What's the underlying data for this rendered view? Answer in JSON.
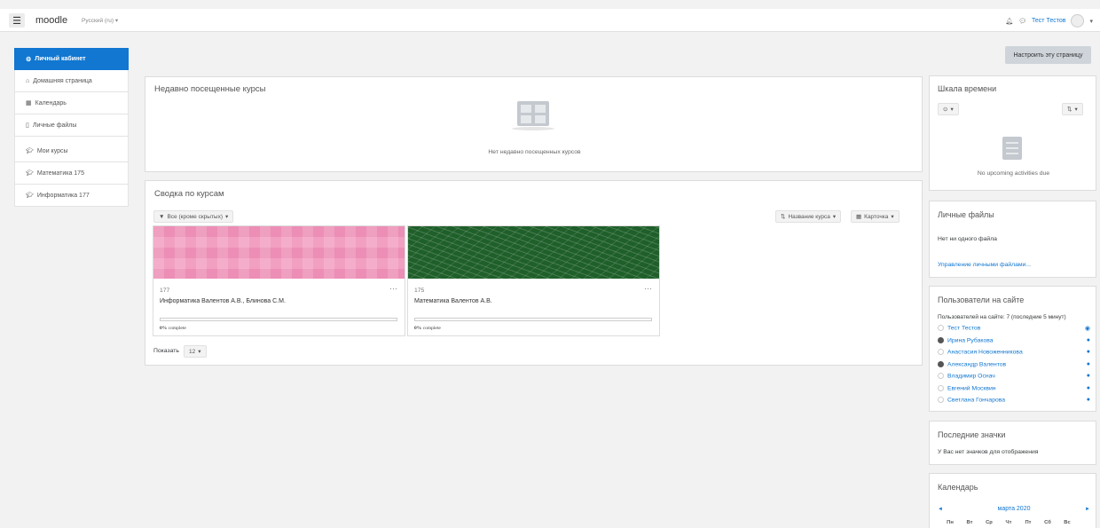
{
  "navbar": {
    "brand": "moodle",
    "language": "Русский (ru)",
    "user_name": "Тест Тестов"
  },
  "sidebar": {
    "items": [
      {
        "label": "Личный кабинет",
        "active": true
      },
      {
        "label": "Домашняя страница"
      },
      {
        "label": "Календарь"
      },
      {
        "label": "Личные файлы"
      },
      {
        "label": "Мои курсы"
      },
      {
        "label": "Математика 175"
      },
      {
        "label": "Информатика 177"
      }
    ]
  },
  "customize_button": "Настроить эту страницу",
  "recent": {
    "title": "Недавно посещенные курсы",
    "empty": "Нет недавно посещенных курсов"
  },
  "overview": {
    "title": "Сводка по курсам",
    "filter": "Все (кроме скрытых)",
    "sort": "Название курса",
    "view": "Карточка",
    "courses": [
      {
        "number": "177",
        "name": "Информатика Валентов А.В., Блинова С.М.",
        "progress_pct": "0%",
        "complete_label": " complete",
        "progress": 0
      },
      {
        "number": "175",
        "name": "Математика Валентов А.В.",
        "progress_pct": "0%",
        "complete_label": " complete",
        "progress": 0
      }
    ],
    "show_label": "Показать",
    "show_value": "12"
  },
  "timeline": {
    "title": "Шкала времени",
    "empty": "No upcoming activities due"
  },
  "files": {
    "title": "Личные файлы",
    "empty": "Нет ни одного файла",
    "manage": "Управление личными файлами..."
  },
  "online": {
    "title": "Пользователи на сайте",
    "summary": "Пользователей на сайте: 7 (последние 5 минут)",
    "users": [
      "Тест Тестов",
      "Ирина Рубакова",
      "Анастасия Новоженникова",
      "Александр Валентов",
      "Владимир Оснач",
      "Евгений Москвин",
      "Светлана Гончарова"
    ]
  },
  "badges": {
    "title": "Последние значки",
    "empty": "У Вас нет значков для отображения"
  },
  "calendar": {
    "title": "Календарь",
    "month": "марта 2020",
    "prev": "◄",
    "next": "►",
    "weekdays": [
      "Пн",
      "Вт",
      "Ср",
      "Чт",
      "Пт",
      "Сб",
      "Вс"
    ]
  }
}
